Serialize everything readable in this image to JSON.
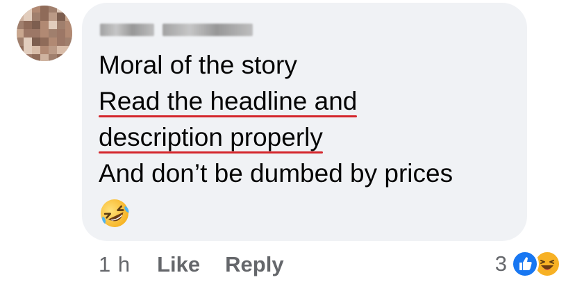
{
  "comment": {
    "author_name": "[blurred name]",
    "lines": [
      "Moral of the story",
      "Read the headline and",
      "description properly",
      "And don’t be dumbed by prices"
    ],
    "emoji": "rolling-on-the-floor-laughing"
  },
  "actions": {
    "time": "1 h",
    "like_label": "Like",
    "reply_label": "Reply"
  },
  "reactions": {
    "count": "3",
    "types": [
      "like",
      "haha"
    ]
  },
  "colors": {
    "bubble_bg": "#f0f2f5",
    "text": "#050505",
    "secondary_text": "#65676b",
    "underline": "#d4252b",
    "like_blue": "#1877f2",
    "haha_yellow": "#f7b125"
  }
}
